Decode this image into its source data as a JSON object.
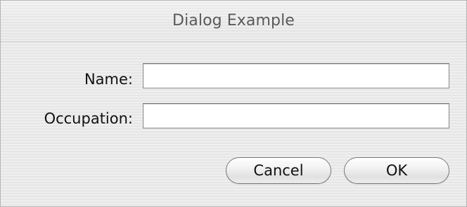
{
  "window": {
    "title": "Dialog Example"
  },
  "form": {
    "name_label": "Name:",
    "name_value": "",
    "occupation_label": "Occupation:",
    "occupation_value": ""
  },
  "buttons": {
    "cancel_label": "Cancel",
    "ok_label": "OK"
  }
}
